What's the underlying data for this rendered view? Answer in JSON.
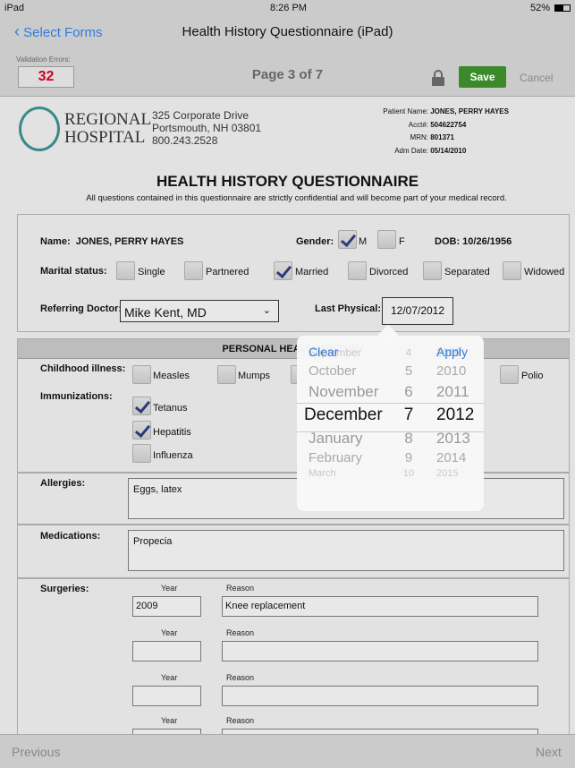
{
  "status": {
    "device": "iPad",
    "time": "8:26 PM",
    "battery": "52%"
  },
  "nav": {
    "back": "Select Forms",
    "title": "Health History Questionnaire (iPad)"
  },
  "toolbar": {
    "validation_label": "Validation Errors:",
    "validation_count": "32",
    "page": "Page 3 of 7",
    "save": "Save",
    "cancel": "Cancel"
  },
  "header": {
    "logo_line1": "REGIONAL",
    "logo_line2": "HOSPITAL",
    "addr1": "325 Corporate Drive",
    "addr2": "Portsmouth, NH 03801",
    "phone": "800.243.2528",
    "patient": [
      {
        "k": "Patient Name:",
        "v": "JONES, PERRY HAYES"
      },
      {
        "k": "Acct#:",
        "v": "504622754"
      },
      {
        "k": "MRN:",
        "v": "801371"
      },
      {
        "k": "Adm Date:",
        "v": "05/14/2010"
      }
    ]
  },
  "form": {
    "title": "HEALTH HISTORY QUESTIONNAIRE",
    "subtitle": "All questions contained in this questionnaire are strictly confidential and will become part of your medical record.",
    "name_label": "Name:",
    "name": "JONES, PERRY HAYES",
    "gender_label": "Gender:",
    "gender_m": "M",
    "gender_f": "F",
    "dob": "DOB: 10/26/1956",
    "marital_label": "Marital status:",
    "marital": [
      "Single",
      "Partnered",
      "Married",
      "Divorced",
      "Separated",
      "Widowed"
    ],
    "ref_label": "Referring Doctor:",
    "ref_value": "Mike Kent, MD",
    "last_label": "Last Physical:",
    "last_value": "12/07/2012",
    "section": "PERSONAL HEALTH HISTORY",
    "child_label": "Childhood illness:",
    "child": [
      "Measles",
      "Mumps",
      "Polio"
    ],
    "imm_label": "Immunizations:",
    "imm": [
      "Tetanus",
      "Hepatitis",
      "Influenza"
    ],
    "allergies_label": "Allergies:",
    "allergies": "Eggs, latex",
    "med_label": "Medications:",
    "medications": "Propecia",
    "surg_label": "Surgeries:",
    "year": "Year",
    "reason": "Reason",
    "surg1_year": "2009",
    "surg1_reason": "Knee replacement"
  },
  "picker": {
    "clear": "Clear",
    "apply": "Apply",
    "rows": [
      [
        "September",
        "4",
        "2009"
      ],
      [
        "October",
        "5",
        "2010"
      ],
      [
        "November",
        "6",
        "2011"
      ],
      [
        "December",
        "7",
        "2012"
      ],
      [
        "January",
        "8",
        "2013"
      ],
      [
        "February",
        "9",
        "2014"
      ],
      [
        "March",
        "10",
        "2015"
      ]
    ]
  },
  "footer": {
    "prev": "Previous",
    "next": "Next"
  },
  "colors": {
    "accent": "#2f7be0",
    "save": "#3a8a2a",
    "error": "#d0021b"
  }
}
